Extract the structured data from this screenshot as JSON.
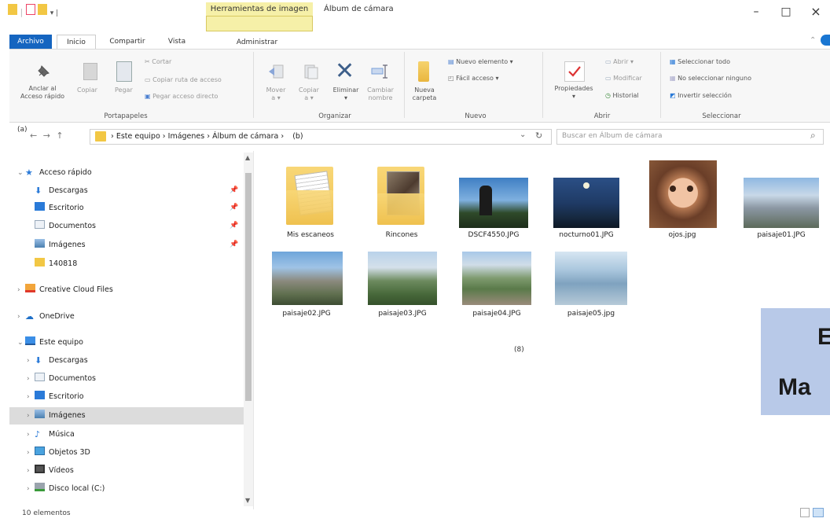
{
  "window": {
    "context_tab": "Herramientas de imagen",
    "title": "Álbum de cámara",
    "minimize": "–",
    "maximize": "□",
    "close": "×"
  },
  "tabs": [
    {
      "label": "Archivo"
    },
    {
      "label": "Inicio"
    },
    {
      "label": "Compartir"
    },
    {
      "label": "Vista"
    },
    {
      "label": "Administrar"
    }
  ],
  "ribbon": {
    "portapapeles": {
      "group": "Portapapeles",
      "anclar_1": "Anclar al",
      "anclar_2": "Acceso rápido",
      "copiar": "Copiar",
      "pegar": "Pegar",
      "cortar": "Cortar",
      "copiar_ruta": "Copiar ruta de acceso",
      "pegar_acceso": "Pegar acceso directo"
    },
    "organizar": {
      "group": "Organizar",
      "mover_1": "Mover",
      "mover_2": "a ▾",
      "copiar_1": "Copiar",
      "copiar_2": "a ▾",
      "eliminar": "Eliminar",
      "eliminar_2": "▾",
      "cambiar_1": "Cambiar",
      "cambiar_2": "nombre"
    },
    "nuevo": {
      "group": "Nuevo",
      "carpeta_1": "Nueva",
      "carpeta_2": "carpeta",
      "elemento": "Nuevo elemento ▾",
      "facil": "Fácil acceso ▾"
    },
    "abrir": {
      "group": "Abrir",
      "propiedades": "Propiedades",
      "propiedades_2": "▾",
      "abrir": "Abrir ▾",
      "modificar": "Modificar",
      "historial": "Historial"
    },
    "seleccionar": {
      "group": "Seleccionar",
      "todo": "Seleccionar todo",
      "ninguno": "No seleccionar ninguno",
      "invertir": "Invertir selección"
    }
  },
  "address": {
    "annotation_a": "(a)",
    "nav_arrows": "←  →  ↑",
    "path": [
      "Este equipo",
      "Imágenes",
      "Álbum de cámara"
    ],
    "separator": "›",
    "annotation_b": "(b)",
    "dropdown": "⌄",
    "refresh": "↻",
    "search_placeholder": "Buscar en Álbum de cámara",
    "search_icon": "⌕"
  },
  "sidebar": {
    "quick_access": "Acceso rápido",
    "quick_items": [
      "Descargas",
      "Escritorio",
      "Documentos",
      "Imágenes",
      "140818"
    ],
    "pin": "📌",
    "creative_cloud": "Creative Cloud Files",
    "onedrive": "OneDrive",
    "este_equipo": "Este equipo",
    "pc_items": [
      "Descargas",
      "Documentos",
      "Escritorio",
      "Imágenes",
      "Música",
      "Objetos 3D",
      "Vídeos",
      "Disco local (C:)"
    ],
    "expand": "›",
    "collapse": "⌄"
  },
  "files": [
    {
      "name": "Mis escaneos",
      "kind": "folder"
    },
    {
      "name": "Rincones",
      "kind": "folder"
    },
    {
      "name": "DSCF4550.JPG",
      "kind": "photo"
    },
    {
      "name": "nocturno01.JPG",
      "kind": "photo"
    },
    {
      "name": "ojos.jpg",
      "kind": "photo"
    },
    {
      "name": "paisaje01.JPG",
      "kind": "photo"
    },
    {
      "name": "paisaje02.JPG",
      "kind": "photo"
    },
    {
      "name": "paisaje03.JPG",
      "kind": "photo"
    },
    {
      "name": "paisaje04.JPG",
      "kind": "photo"
    },
    {
      "name": "paisaje05.jpg",
      "kind": "photo"
    }
  ],
  "content_annotation": "(8)",
  "overlay": {
    "line1": "E",
    "line2": "Ma"
  },
  "status": "10 elementos",
  "colors": {
    "accent": "#1565c0",
    "context_tab": "#f6f0a8",
    "selected_row": "#dcdcdc",
    "overlay_box": "#b8c9e8"
  }
}
